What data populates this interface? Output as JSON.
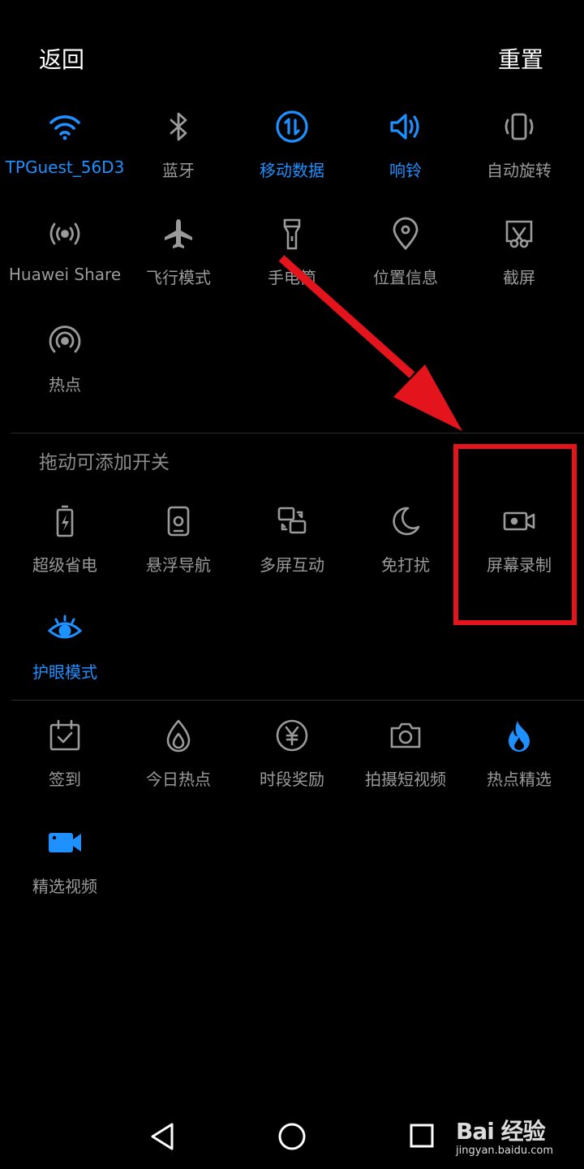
{
  "header": {
    "back_label": "返回",
    "reset_label": "重置"
  },
  "active_tiles": [
    {
      "label": "TPGuest_56D3",
      "icon": "wifi-icon",
      "active": true
    },
    {
      "label": "蓝牙",
      "icon": "bluetooth-icon",
      "active": false
    },
    {
      "label": "移动数据",
      "icon": "mobile-data-icon",
      "active": true
    },
    {
      "label": "响铃",
      "icon": "volume-icon",
      "active": true
    },
    {
      "label": "自动旋转",
      "icon": "auto-rotate-icon",
      "active": false
    },
    {
      "label": "Huawei Share",
      "icon": "huawei-share-icon",
      "active": false
    },
    {
      "label": "飞行模式",
      "icon": "airplane-icon",
      "active": false
    },
    {
      "label": "手电筒",
      "icon": "flashlight-icon",
      "active": false
    },
    {
      "label": "位置信息",
      "icon": "location-icon",
      "active": false
    },
    {
      "label": "截屏",
      "icon": "screenshot-icon",
      "active": false
    },
    {
      "label": "热点",
      "icon": "hotspot-icon",
      "active": false
    }
  ],
  "available_section": {
    "title": "拖动可添加开关",
    "tiles": [
      {
        "label": "超级省电",
        "icon": "battery-saver-icon",
        "active": false
      },
      {
        "label": "悬浮导航",
        "icon": "floating-nav-icon",
        "active": false
      },
      {
        "label": "多屏互动",
        "icon": "multi-screen-icon",
        "active": false
      },
      {
        "label": "免打扰",
        "icon": "moon-icon",
        "active": false
      },
      {
        "label": "屏幕录制",
        "icon": "screen-record-icon",
        "active": false
      },
      {
        "label": "护眼模式",
        "icon": "eye-icon",
        "active": true
      }
    ]
  },
  "app_tiles": [
    {
      "label": "签到",
      "icon": "check-in-icon"
    },
    {
      "label": "今日热点",
      "icon": "drop-icon"
    },
    {
      "label": "时段奖励",
      "icon": "yuan-icon"
    },
    {
      "label": "拍摄短视频",
      "icon": "camera-icon"
    },
    {
      "label": "热点精选",
      "icon": "flame-icon"
    },
    {
      "label": "精选视频",
      "icon": "video-icon"
    }
  ],
  "watermark": {
    "brand": "Bai 经验",
    "url": "jingyan.baidu.com"
  },
  "colors": {
    "background": "#000000",
    "accent": "#1e90ff",
    "inactive": "#9a9a9a",
    "annotation": "#e3141b",
    "flame": "#1e90ff",
    "video": "#1e90ff"
  },
  "navigation": {
    "buttons": [
      "back-triangle-icon",
      "home-circle-icon",
      "recents-square-icon"
    ]
  }
}
